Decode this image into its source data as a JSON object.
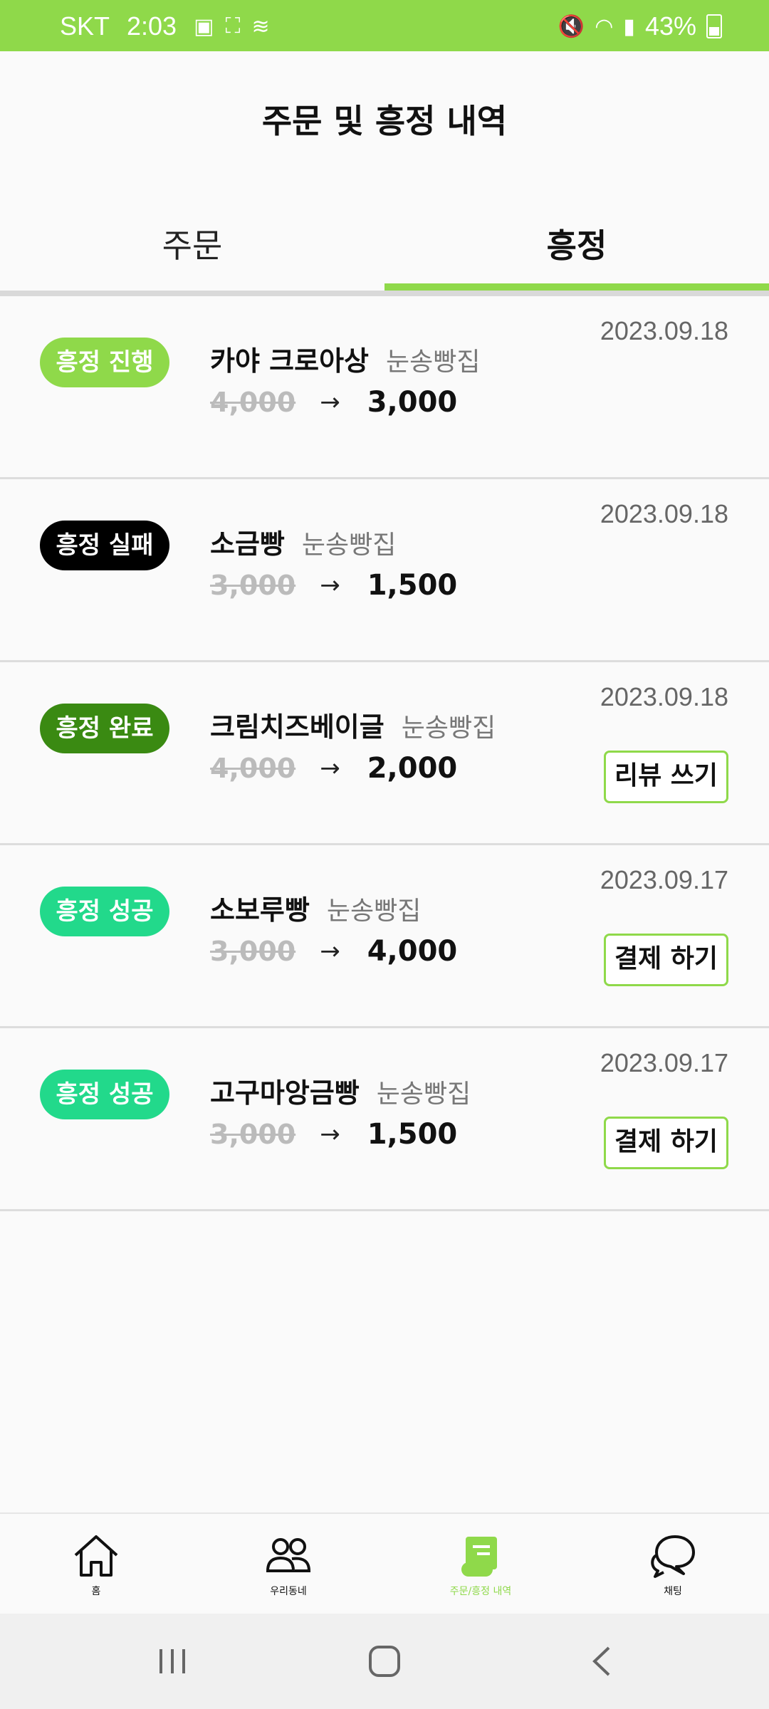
{
  "status_bar": {
    "carrier": "SKT",
    "time": "2:03",
    "battery": "43%"
  },
  "header": {
    "title": "주문 및 흥정 내역"
  },
  "tabs": [
    {
      "label": "주문",
      "active": false
    },
    {
      "label": "흥정",
      "active": true
    }
  ],
  "items": [
    {
      "status": "흥정 진행",
      "status_color": "#8fd94a",
      "name": "카야 크로아상",
      "shop": "눈송빵집",
      "old_price": "4,000",
      "arrow": "→",
      "new_price": "3,000",
      "date": "2023.09.18",
      "action": ""
    },
    {
      "status": "흥정 실패",
      "status_color": "#000000",
      "name": "소금빵",
      "shop": "눈송빵집",
      "old_price": "3,000",
      "arrow": "→",
      "new_price": "1,500",
      "date": "2023.09.18",
      "action": ""
    },
    {
      "status": "흥정 완료",
      "status_color": "#3a8a12",
      "name": "크림치즈베이글",
      "shop": "눈송빵집",
      "old_price": "4,000",
      "arrow": "→",
      "new_price": "2,000",
      "date": "2023.09.18",
      "action": "리뷰 쓰기"
    },
    {
      "status": "흥정 성공",
      "status_color": "#22d98b",
      "name": "소보루빵",
      "shop": "눈송빵집",
      "old_price": "3,000",
      "arrow": "→",
      "new_price": "4,000",
      "date": "2023.09.17",
      "action": "결제 하기"
    },
    {
      "status": "흥정 성공",
      "status_color": "#22d98b",
      "name": "고구마앙금빵",
      "shop": "눈송빵집",
      "old_price": "3,000",
      "arrow": "→",
      "new_price": "1,500",
      "date": "2023.09.17",
      "action": "결제 하기"
    }
  ],
  "bottom_nav": [
    {
      "label": "홈",
      "icon": "home-icon",
      "active": false
    },
    {
      "label": "우리동네",
      "icon": "neighbors-icon",
      "active": false
    },
    {
      "label": "주문/흥정 내역",
      "icon": "receipt-icon",
      "active": true
    },
    {
      "label": "채팅",
      "icon": "chat-icon",
      "active": false
    }
  ],
  "colors": {
    "accent": "#8fd94a",
    "success": "#22d98b",
    "complete": "#3a8a12",
    "fail": "#000000"
  }
}
